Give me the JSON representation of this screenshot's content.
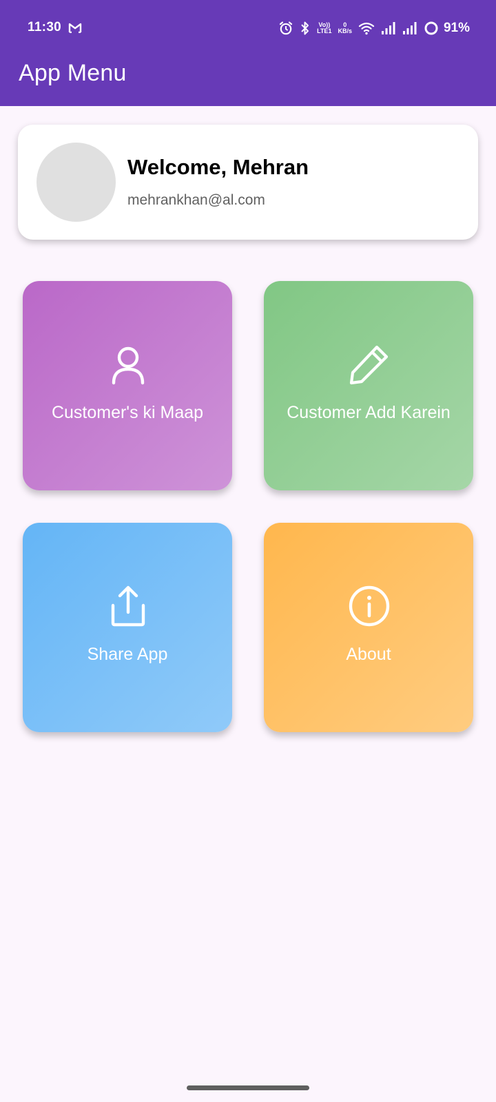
{
  "status_bar": {
    "time": "11:30",
    "volte_top": "Vo))",
    "volte_bottom": "LTE1",
    "net_speed_value": "0",
    "net_speed_unit": "KB/s",
    "battery_percent": "91%",
    "icons": [
      "gmail-icon",
      "alarm-icon",
      "bluetooth-icon",
      "volte-icon",
      "wifi-icon",
      "signal-sim1-icon",
      "signal-sim2-icon",
      "battery-ring-icon"
    ]
  },
  "app_bar": {
    "title": "App Menu",
    "color": "#673ab7"
  },
  "profile": {
    "welcome": "Welcome, Mehran",
    "email": "mehrankhan@al.com",
    "avatar_color": "#e0e0e0"
  },
  "menu": {
    "items": [
      {
        "label": "Customer's ki Maap",
        "icon": "person-icon",
        "gradient": [
          "#ba68c8",
          "#ce93d8"
        ]
      },
      {
        "label": "Customer Add Karein",
        "icon": "edit-pencil-icon",
        "gradient": [
          "#81c784",
          "#a5d6a7"
        ]
      },
      {
        "label": "Share App",
        "icon": "share-icon",
        "gradient": [
          "#64b5f6",
          "#90caf9"
        ]
      },
      {
        "label": "About",
        "icon": "info-icon",
        "gradient": [
          "#ffb74d",
          "#ffcc80"
        ]
      }
    ]
  },
  "colors": {
    "background": "#fcf5fd",
    "card": "#ffffff",
    "nav_handle": "#5f5f5f"
  }
}
